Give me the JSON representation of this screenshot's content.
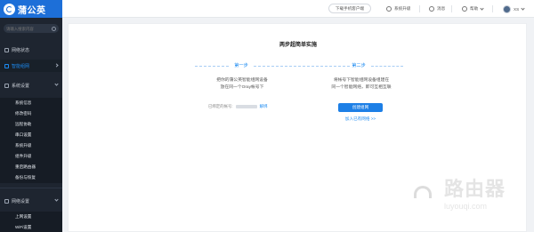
{
  "brand": {
    "name": "蒲公英"
  },
  "sidebar": {
    "search_placeholder": "请输入搜索内容",
    "nav": [
      {
        "label": "网络状态"
      },
      {
        "label": "智能组网"
      },
      {
        "label": "系统设置"
      },
      {
        "label": "网络设置"
      }
    ],
    "sub_items": [
      {
        "label": "系统信息"
      },
      {
        "label": "修改密码"
      },
      {
        "label": "远程协助"
      },
      {
        "label": "串口设置"
      },
      {
        "label": "系统升级"
      },
      {
        "label": "组件升级"
      },
      {
        "label": "重启路由器"
      },
      {
        "label": "备份与恢复"
      }
    ],
    "network_sub_items": [
      {
        "label": "上网设置"
      },
      {
        "label": "WiFi设置"
      }
    ]
  },
  "topbar": {
    "download_label": "下载手机客户端",
    "upgrade_label": "系统升级",
    "messages_label": "消息",
    "help_label": "帮助",
    "user_label": "XS"
  },
  "card": {
    "title": "两步超简单实施",
    "step1_label": "第一步",
    "step2_label": "第二步",
    "step1_desc_1": "把你的蒲公英智能组网设备",
    "step1_desc_2": "放在同一个Oray帐号下",
    "step2_desc_1": "将帐号下智能组网设备组建在",
    "step2_desc_2": "同一个智能网络，即可互相互联",
    "bound_account_label": "已绑定的帐号:",
    "unbind_label": "解绑",
    "primary_button": "创建组网",
    "join_link": "加入已有网络 >>"
  },
  "watermark": {
    "cn": "路由器",
    "en": "luyouqi.com"
  }
}
